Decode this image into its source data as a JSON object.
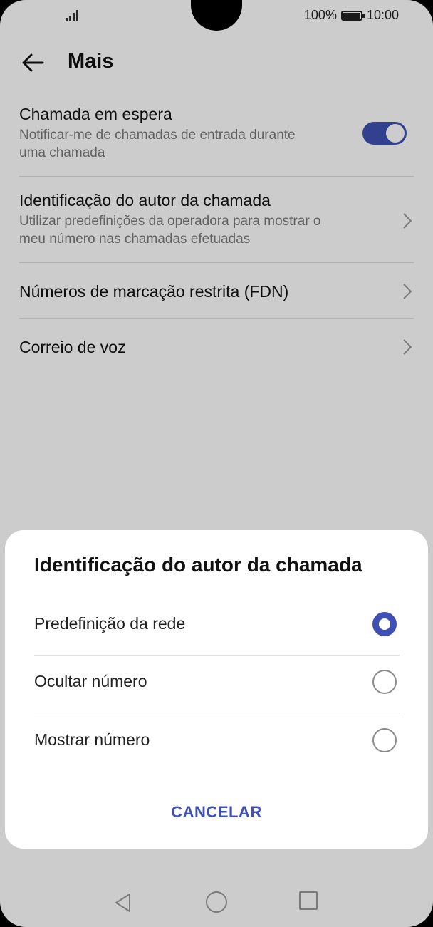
{
  "status_bar": {
    "battery": "100%",
    "time": "10:00"
  },
  "appbar": {
    "title": "Mais"
  },
  "settings": [
    {
      "title": "Chamada em espera",
      "subtitle_line1": "Notificar-me de chamadas de entrada durante",
      "subtitle_line2": "uma chamada",
      "control": "toggle-on"
    },
    {
      "title": "Identificação do autor da chamada",
      "subtitle_line1": "Utilizar predefinições da operadora para mostrar o",
      "subtitle_line2": "meu número nas chamadas efetuadas",
      "control": "chevron-right-icon"
    },
    {
      "title": "Números de marcação restrita (FDN)",
      "control": "chevron-right-icon"
    },
    {
      "title": "Correio de voz",
      "control": "chevron-right-icon"
    }
  ],
  "dialog": {
    "title": "Identificação do autor da chamada",
    "options": [
      {
        "label": "Predefinição da rede",
        "selected": true
      },
      {
        "label": "Ocultar número",
        "selected": false
      },
      {
        "label": "Mostrar número",
        "selected": false
      }
    ],
    "cancel_label": "CANCELAR"
  },
  "colors": {
    "accent": "#3f51b5",
    "scrim": "rgba(0,0,0,0.2)"
  },
  "navbar": {
    "icons": [
      "back-triangle-icon",
      "home-circle-icon",
      "recents-square-icon"
    ]
  }
}
